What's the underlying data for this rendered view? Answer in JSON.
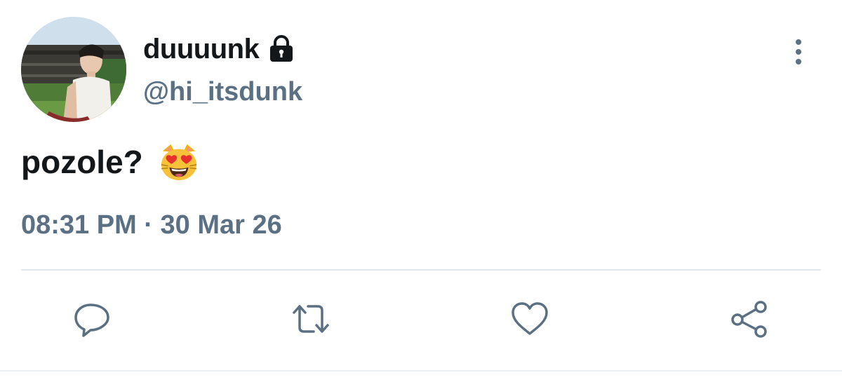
{
  "user": {
    "display_name": "duuuunk",
    "handle": "@hi_itsdunk",
    "protected": true
  },
  "icons": {
    "lock": "lock-icon",
    "more": "more-vertical-icon",
    "emoji": "smiling-cat-heart-eyes-emoji",
    "reply": "reply-icon",
    "retweet": "retweet-icon",
    "like": "heart-icon",
    "share": "share-icon"
  },
  "tweet": {
    "text": "pozole?",
    "timestamp": "08:31 PM · 30 Mar 26"
  },
  "colors": {
    "text_primary": "#14171a",
    "text_secondary": "#5b7083",
    "divider": "#e1e8ed"
  }
}
